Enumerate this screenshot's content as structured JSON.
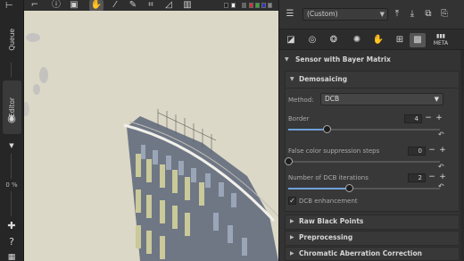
{
  "sidebar": {
    "queue_label": "Queue",
    "editor_label": "Editor",
    "progress_text": "0 %"
  },
  "profile": {
    "selected": "(Custom)"
  },
  "sections": {
    "sensor_title": "Sensor with Bayer Matrix",
    "demosaicing_title": "Demosaicing",
    "raw_black_points_title": "Raw Black Points",
    "preprocessing_title": "Preprocessing",
    "chromatic_title": "Chromatic Aberration Correction"
  },
  "demosaicing": {
    "method_label": "Method:",
    "method_value": "DCB",
    "border_label": "Border",
    "border_value": "4",
    "border_fraction": 0.25,
    "false_color_label": "False color suppression steps",
    "false_color_value": "0",
    "false_color_fraction": 0.0,
    "dcb_iterations_label": "Number of DCB iterations",
    "dcb_iterations_value": "2",
    "dcb_iterations_fraction": 0.4,
    "dcb_enhancement_label": "DCB enhancement",
    "dcb_enhancement_checked": true
  },
  "tabs": {
    "meta_label": "META"
  },
  "colors": {
    "accent": "#6ea0d8",
    "panel_bg": "#333333",
    "image_bg": "#ddd9c8"
  }
}
